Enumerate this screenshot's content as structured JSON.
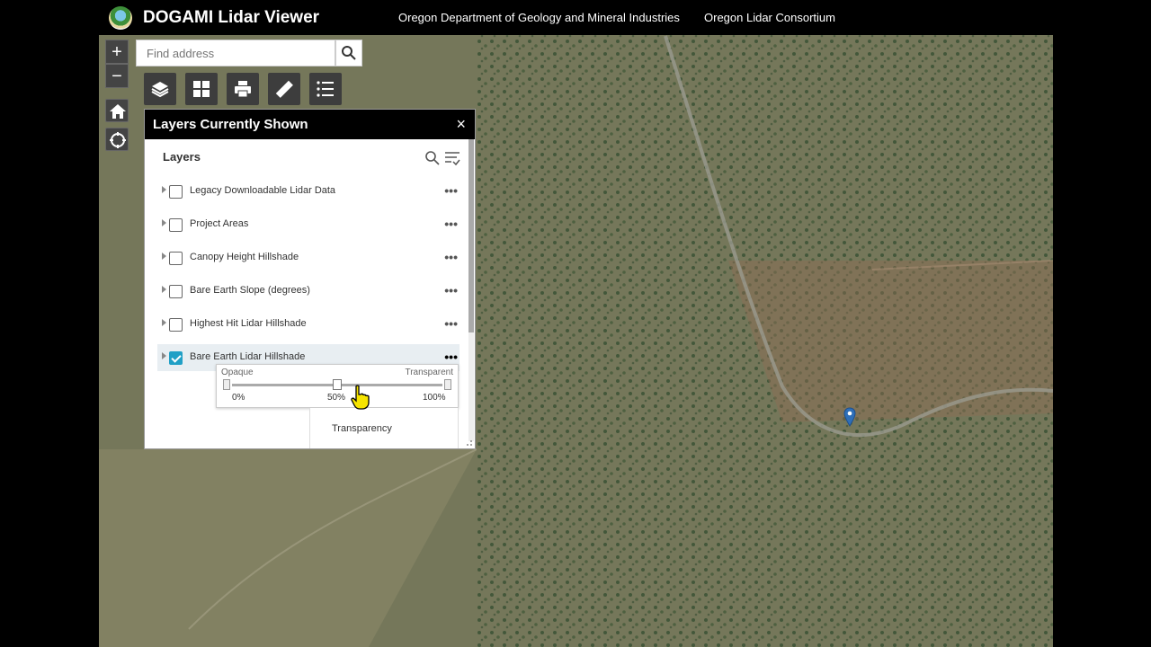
{
  "header": {
    "app_title": "DOGAMI Lidar Viewer",
    "link_dogami": "Oregon Department of Geology and Mineral Industries",
    "link_consortium": "Oregon Lidar Consortium"
  },
  "map_controls": {
    "zoom_in": "+",
    "zoom_out": "−"
  },
  "search": {
    "placeholder": "Find address"
  },
  "toolbar": {
    "icons": [
      "layers-icon",
      "basemap-grid-icon",
      "print-icon",
      "measure-ruler-icon",
      "legend-list-icon"
    ]
  },
  "layer_panel": {
    "title": "Layers Currently Shown",
    "close": "×",
    "section_label": "Layers",
    "layers": [
      {
        "label": "Legacy Downloadable Lidar Data",
        "checked": false
      },
      {
        "label": "Project Areas",
        "checked": false
      },
      {
        "label": "Canopy Height Hillshade",
        "checked": false
      },
      {
        "label": "Bare Earth Slope (degrees)",
        "checked": false
      },
      {
        "label": "Highest Hit Lidar Hillshade",
        "checked": false
      },
      {
        "label": "Bare Earth Lidar Hillshade",
        "checked": true
      }
    ],
    "layer_menu": "•••"
  },
  "transparency": {
    "opaque_label": "Opaque",
    "transparent_label": "Transparent",
    "tick_min": "0%",
    "tick_mid": "50%",
    "tick_max": "100%",
    "value": 0.5,
    "menu_label": "Transparency"
  },
  "colors": {
    "header_bg": "#000000",
    "checkbox_checked": "#21a0c6",
    "pin": "#2f6fb8"
  }
}
